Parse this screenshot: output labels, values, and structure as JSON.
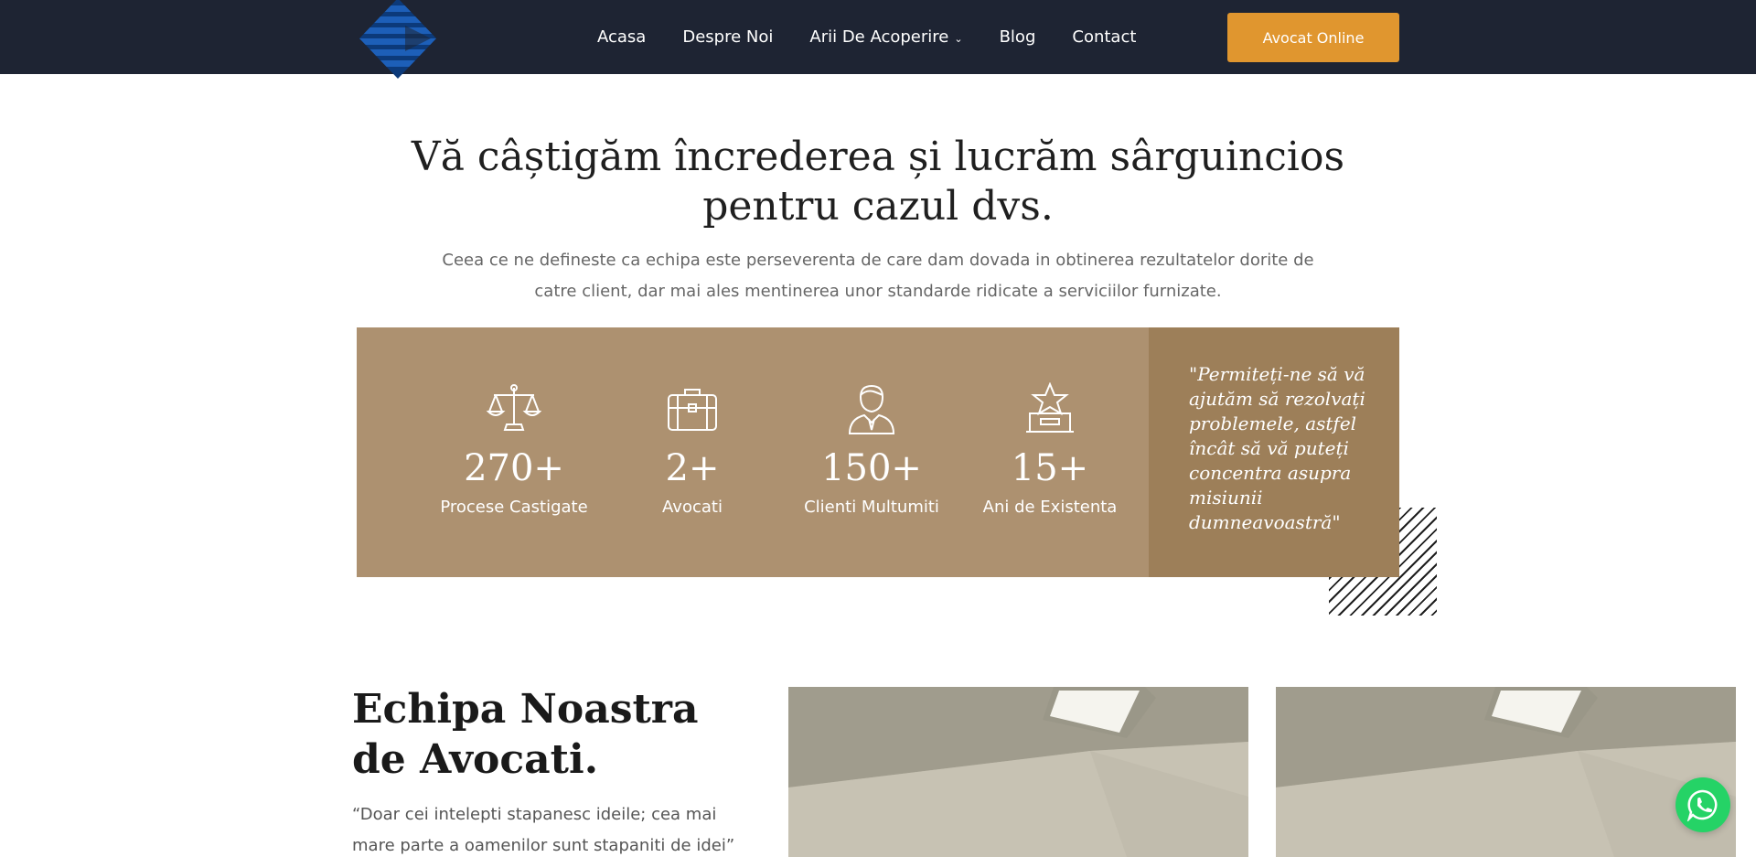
{
  "colors": {
    "header_bg": "#1e2433",
    "accent": "#e0962f",
    "stats_bg": "#ad9170",
    "quote_bg": "#9d7f59",
    "whatsapp": "#25d366"
  },
  "header": {
    "logo_icon": "diamond-logo-icon",
    "nav": [
      {
        "label": "Acasa"
      },
      {
        "label": "Despre Noi"
      },
      {
        "label": "Arii De Acoperire",
        "has_dropdown": true
      },
      {
        "label": "Blog"
      },
      {
        "label": "Contact"
      }
    ],
    "cta_label": "Avocat Online"
  },
  "hero": {
    "headline": "Vă câștigăm încrederea și lucrăm sârguincios pentru cazul dvs.",
    "subtext": "Ceea ce ne defineste ca echipa este perseverenta de care dam dovada in obtinerea rezultatelor dorite de catre client, dar mai ales mentinerea unor standarde ridicate a serviciilor furnizate."
  },
  "stats": [
    {
      "icon": "scales-icon",
      "value": "270+",
      "label": "Procese Castigate"
    },
    {
      "icon": "briefcase-icon",
      "value": "2+",
      "label": "Avocati"
    },
    {
      "icon": "lawyer-icon",
      "value": "150+",
      "label": "Clienti Multumiti"
    },
    {
      "icon": "award-icon",
      "value": "15+",
      "label": "Ani de Existenta"
    }
  ],
  "quote": "\"Permiteți-ne să vă ajutăm să rezolvați problemele, astfel încât să vă puteți concentra asupra misiunii dumneavoastră\"",
  "team": {
    "title": "Echipa Noastra de Avocati.",
    "quote": "“Doar cei intelepti stapanesc ideile; cea mai mare parte a oamenilor sunt stapaniti de idei”"
  },
  "whatsapp_icon": "whatsapp-icon"
}
